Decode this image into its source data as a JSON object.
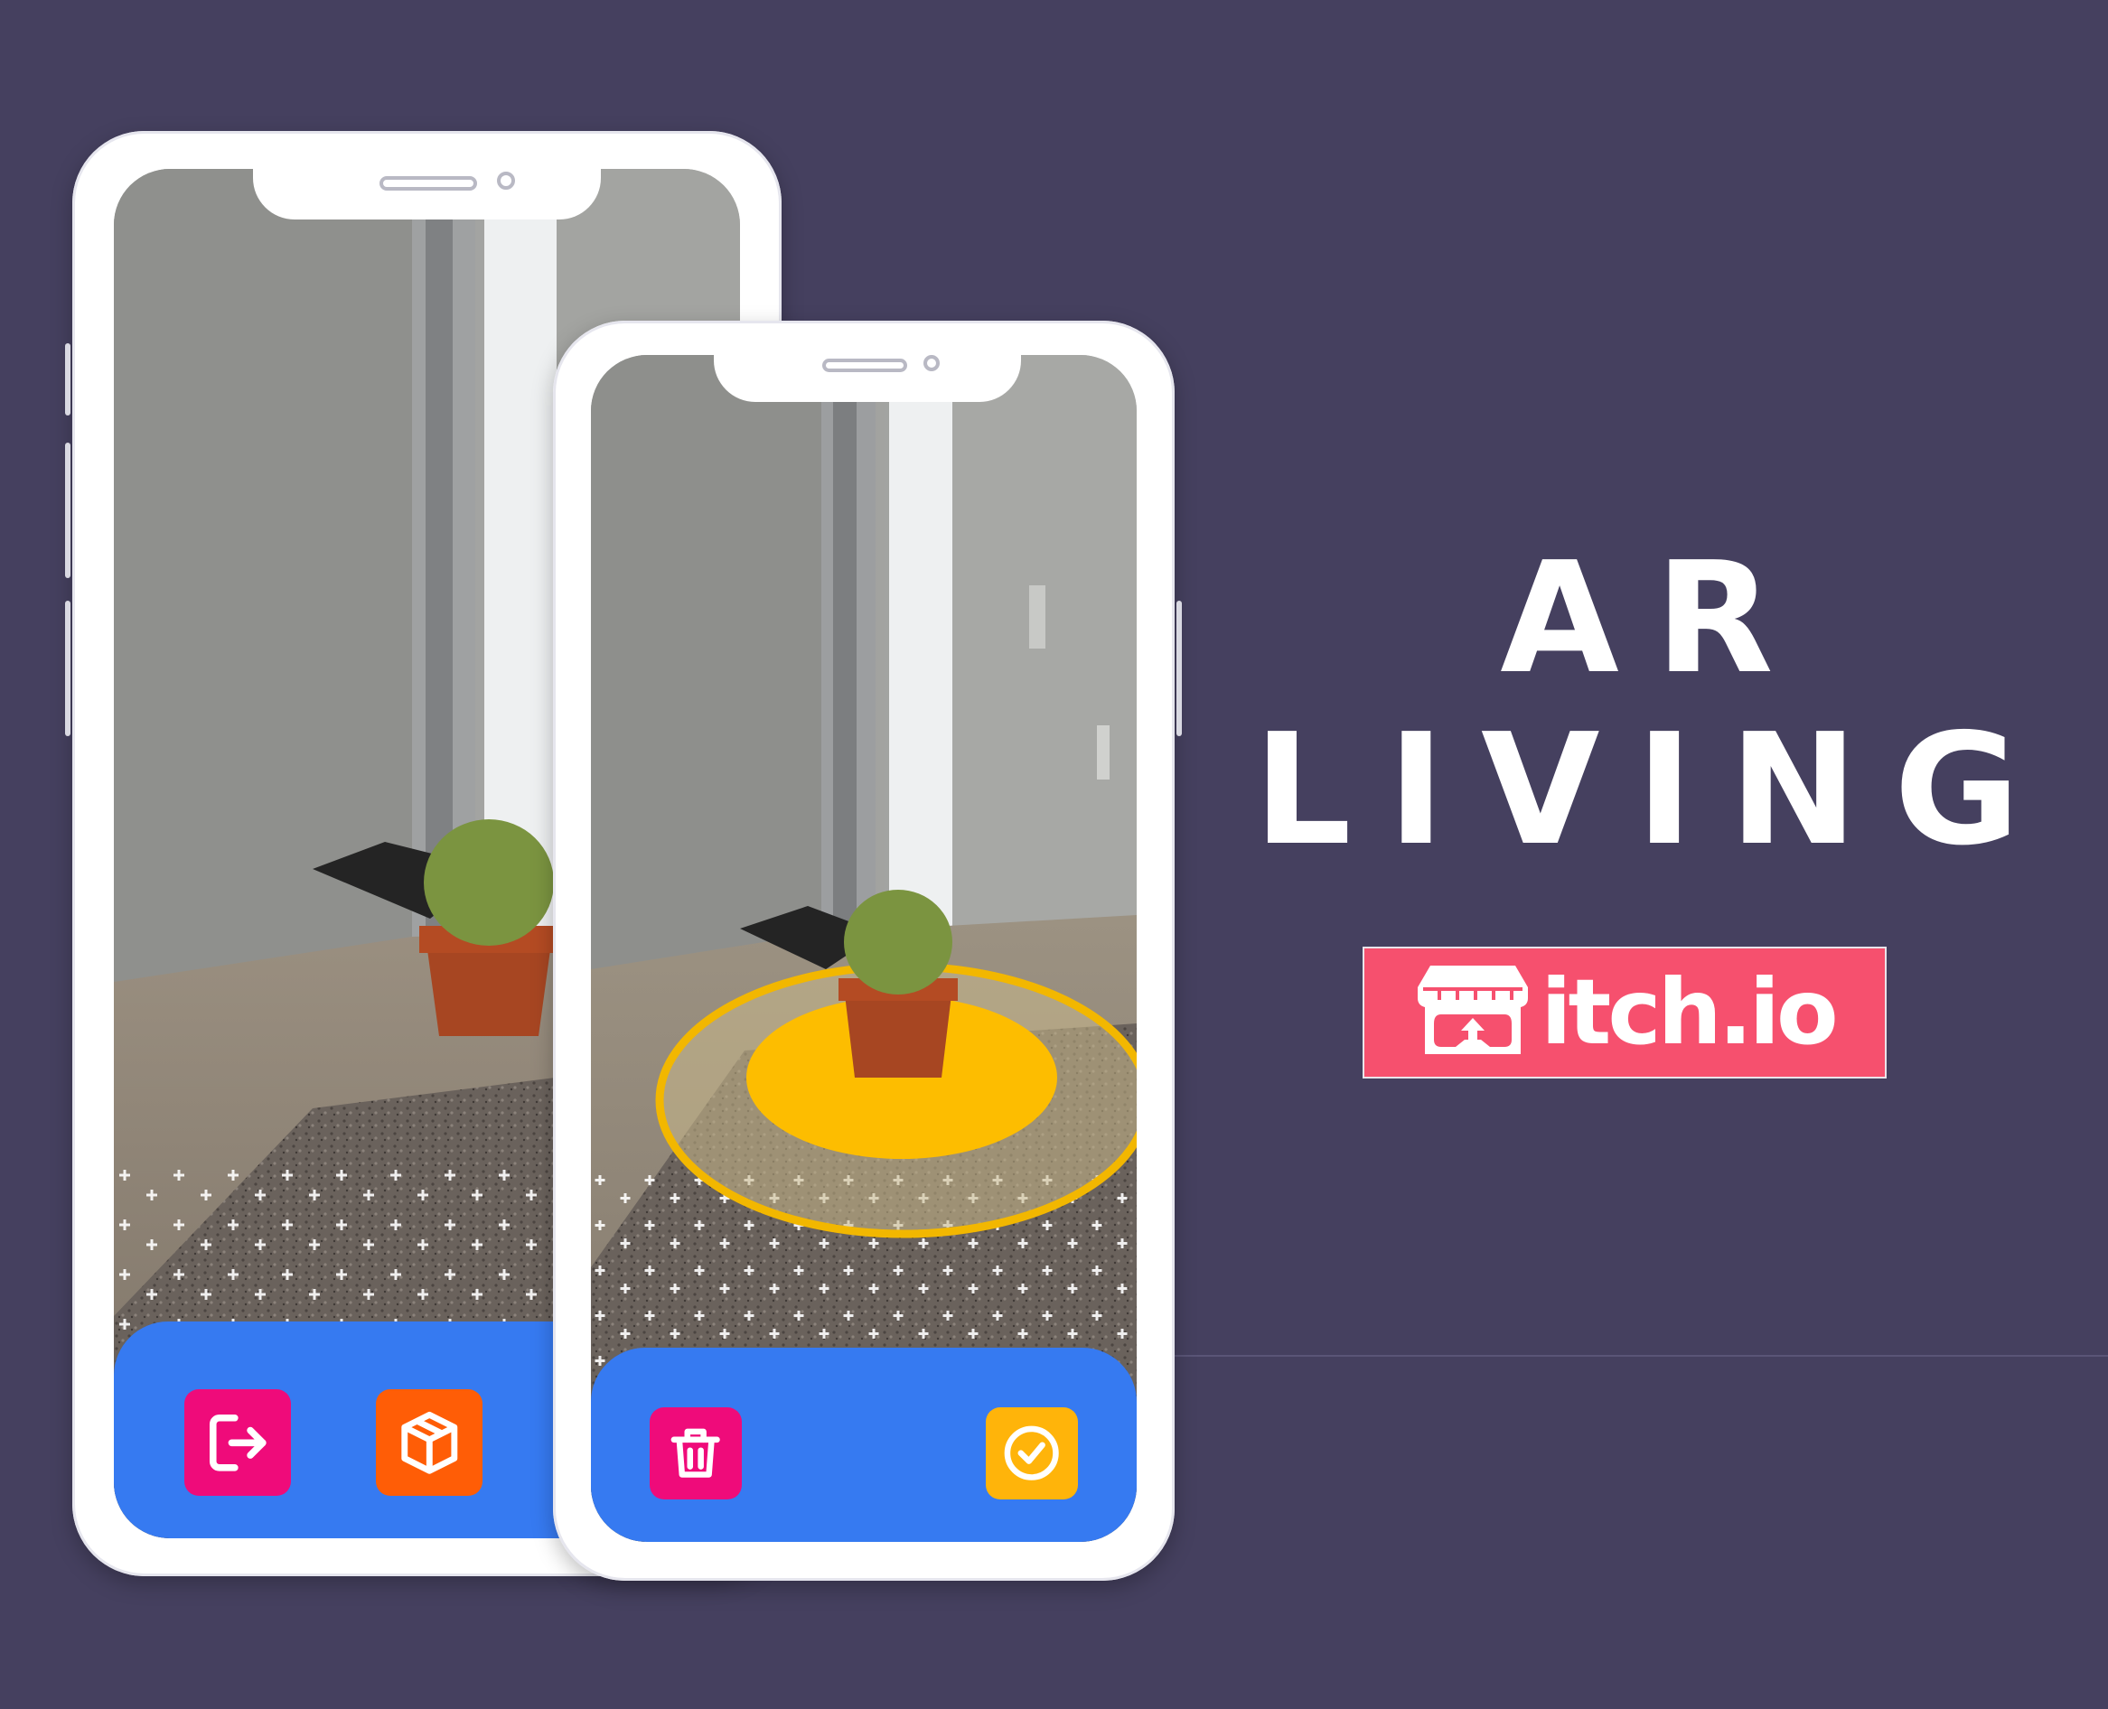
{
  "title": {
    "line1": "AR",
    "line2": "LIVING"
  },
  "badge": {
    "text": "itch.io",
    "logo_icon": "itch-store-icon"
  },
  "colors": {
    "background": "#45405f",
    "bottom_bar": "#367af1",
    "exit_button": "#ef0b7a",
    "cube_button": "#ff5d06",
    "delete_button": "#ef0b7a",
    "confirm_button": "#ffb40a",
    "placement_disc": "#fdbd00",
    "badge": "#f6506e"
  },
  "phone_left": {
    "buttons": [
      {
        "icon": "exit-icon",
        "color": "#ef0b7a"
      },
      {
        "icon": "cube-icon",
        "color": "#ff5d06"
      }
    ]
  },
  "phone_right": {
    "buttons": [
      {
        "icon": "trash-icon",
        "color": "#ef0b7a"
      },
      {
        "icon": "check-circle-icon",
        "color": "#ffb40a"
      }
    ]
  }
}
